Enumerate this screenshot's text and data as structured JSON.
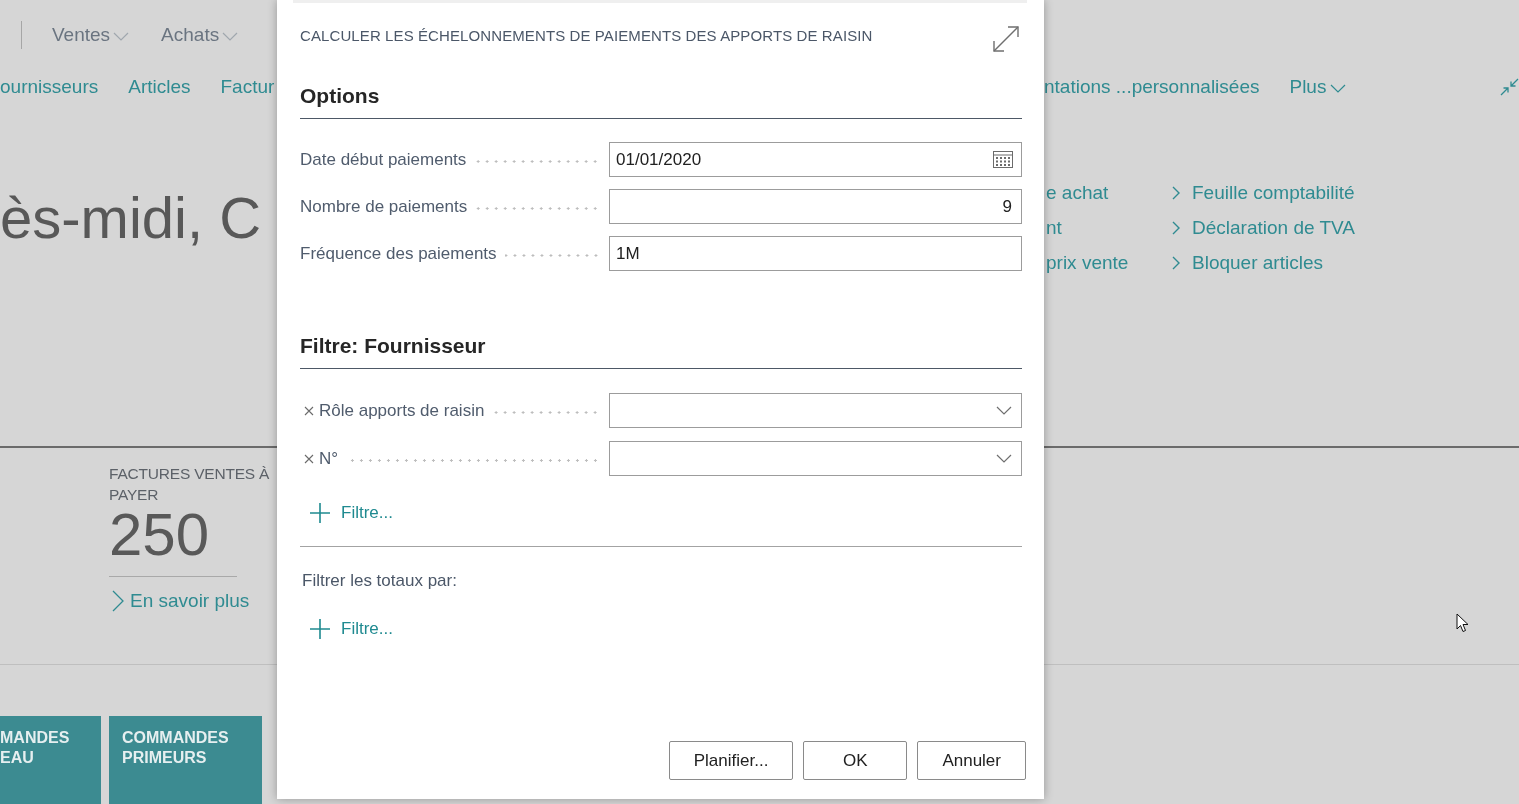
{
  "top_nav": {
    "menus": [
      {
        "label": "Ventes"
      },
      {
        "label": "Achats"
      }
    ]
  },
  "nav_links": {
    "left": [
      "ournisseurs",
      "Articles",
      "Factur"
    ],
    "right": [
      "ntations ...personnalisées"
    ],
    "more": {
      "label": "Plus"
    }
  },
  "greeting": "ès-midi, C",
  "actions": {
    "column_1": [
      "e achat",
      "nt",
      "prix vente"
    ],
    "column_2": [
      "Feuille comptabilité",
      "Déclaration de TVA",
      "Bloquer articles"
    ]
  },
  "cues": [
    {
      "title": "FACTURES VENTES À PAYER",
      "value": "250",
      "link": "En savoir plus"
    }
  ],
  "tiles": [
    {
      "title": "MANDES EAU"
    },
    {
      "title": "COMMANDES PRIMEURS"
    }
  ],
  "dialog": {
    "title": "CALCULER LES ÉCHELONNEMENTS DE PAIEMENTS DES APPORTS DE RAISIN",
    "options": {
      "heading": "Options",
      "fields": [
        {
          "label": "Date début paiements",
          "value": "01/01/2020",
          "kind": "date"
        },
        {
          "label": "Nombre de paiements",
          "value": "9",
          "kind": "number"
        },
        {
          "label": "Fréquence des paiements",
          "value": "1M",
          "kind": "text"
        }
      ]
    },
    "filter": {
      "heading": "Filtre: Fournisseur",
      "fields": [
        {
          "label": "Rôle apports de raisin",
          "kind": "dropdown"
        },
        {
          "label": "N°",
          "kind": "dropdown"
        }
      ],
      "add_filter": "Filtre..."
    },
    "totals": {
      "label": "Filtrer les totaux par:",
      "add_filter": "Filtre..."
    },
    "buttons": [
      {
        "label": "Planifier..."
      },
      {
        "label": "OK"
      },
      {
        "label": "Annuler"
      }
    ]
  }
}
